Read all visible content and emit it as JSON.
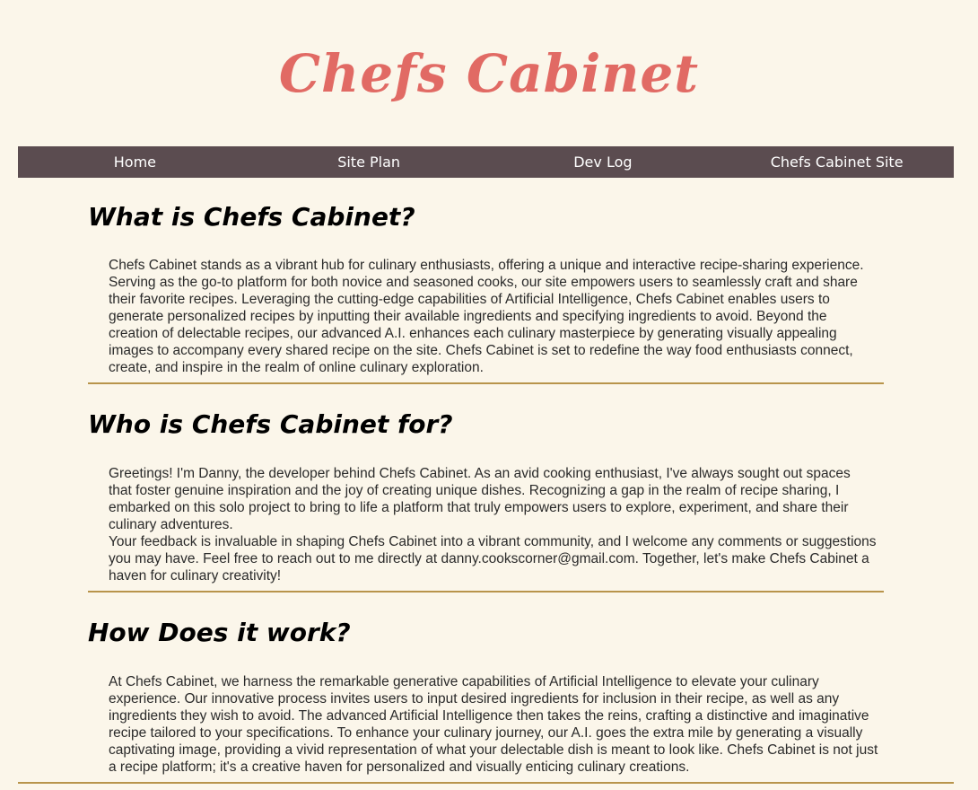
{
  "header": {
    "title": "Chefs Cabinet"
  },
  "nav": {
    "items": [
      {
        "label": "Home"
      },
      {
        "label": "Site Plan"
      },
      {
        "label": "Dev Log"
      },
      {
        "label": "Chefs Cabinet Site"
      }
    ]
  },
  "sections": [
    {
      "heading": "What is Chefs Cabinet?",
      "paragraphs": [
        "Chefs Cabinet stands as a vibrant hub for culinary enthusiasts, offering a unique and interactive recipe-sharing experience. Serving as the go-to platform for both novice and seasoned cooks, our site empowers users to seamlessly craft and share their favorite recipes. Leveraging the cutting-edge capabilities of Artificial Intelligence, Chefs Cabinet enables users to generate personalized recipes by inputting their available ingredients and specifying ingredients to avoid. Beyond the creation of delectable recipes, our advanced A.I. enhances each culinary masterpiece by generating visually appealing images to accompany every shared recipe on the site. Chefs Cabinet is set to redefine the way food enthusiasts connect, create, and inspire in the realm of online culinary exploration."
      ]
    },
    {
      "heading": "Who is Chefs Cabinet for?",
      "paragraphs": [
        "Greetings! I'm Danny, the developer behind Chefs Cabinet. As an avid cooking enthusiast, I've always sought out spaces that foster genuine inspiration and the joy of creating unique dishes. Recognizing a gap in the realm of recipe sharing, I embarked on this solo project to bring to life a platform that truly empowers users to explore, experiment, and share their culinary adventures.",
        "Your feedback is invaluable in shaping Chefs Cabinet into a vibrant community, and I welcome any comments or suggestions you may have. Feel free to reach out to me directly at danny.cookscorner@gmail.com. Together, let's make Chefs Cabinet a haven for culinary creativity!"
      ]
    },
    {
      "heading": "How Does it work?",
      "paragraphs": [
        "At Chefs Cabinet, we harness the remarkable generative capabilities of Artificial Intelligence to elevate your culinary experience. Our innovative process invites users to input desired ingredients for inclusion in their recipe, as well as any ingredients they wish to avoid. The advanced Artificial Intelligence then takes the reins, crafting a distinctive and imaginative recipe tailored to your specifications. To enhance your culinary journey, our A.I. goes the extra mile by generating a visually captivating image, providing a vivid representation of what your delectable dish is meant to look like. Chefs Cabinet is not just a recipe platform; it's a creative haven for personalized and visually enticing culinary creations."
      ]
    }
  ],
  "colors": {
    "background": "#fbf6ea",
    "title": "#e16a64",
    "nav_background": "#5b4c50",
    "nav_text": "#ffffff",
    "divider": "#b8944b"
  }
}
